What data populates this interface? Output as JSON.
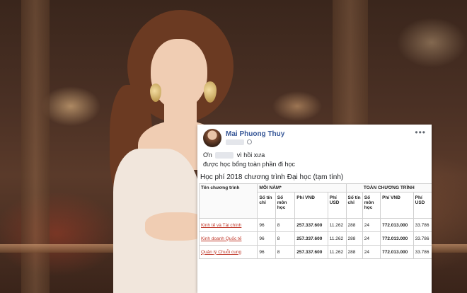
{
  "post": {
    "author": "Mai Phuong Thuy",
    "line1_before": "Ơn",
    "line1_after": "vì hồi xưa",
    "line2": "được học bổng toàn phần đi học",
    "more_label": "•••"
  },
  "table": {
    "title": "Học phí 2018 chương trình Đại học (tạm tính)",
    "col_program": "Tên chương trình",
    "group_year": "MỖI NĂM*",
    "group_total": "TOÀN CHƯƠNG TRÌNH",
    "subheaders": [
      "Số tín chỉ",
      "Số môn học",
      "Phí VNĐ",
      "Phí USD",
      "Số tín chỉ",
      "Số môn học",
      "Phí VNĐ",
      "Phí USD"
    ],
    "rows": [
      {
        "program": "Kinh tế và Tài chính",
        "credits_y": "96",
        "subjects_y": "8",
        "vnd_y": "257.337.600",
        "usd_y": "11.262",
        "credits_t": "288",
        "subjects_t": "24",
        "vnd_t": "772.013.000",
        "usd_t": "33.786"
      },
      {
        "program": "Kinh doanh Quốc tế",
        "credits_y": "96",
        "subjects_y": "8",
        "vnd_y": "257.337.600",
        "usd_y": "11.262",
        "credits_t": "288",
        "subjects_t": "24",
        "vnd_t": "772.013.000",
        "usd_t": "33.786"
      },
      {
        "program": "Quản lý Chuỗi cung",
        "credits_y": "96",
        "subjects_y": "8",
        "vnd_y": "257.337.600",
        "usd_y": "11.262",
        "credits_t": "288",
        "subjects_t": "24",
        "vnd_t": "772.013.000",
        "usd_t": "33.786"
      }
    ]
  }
}
